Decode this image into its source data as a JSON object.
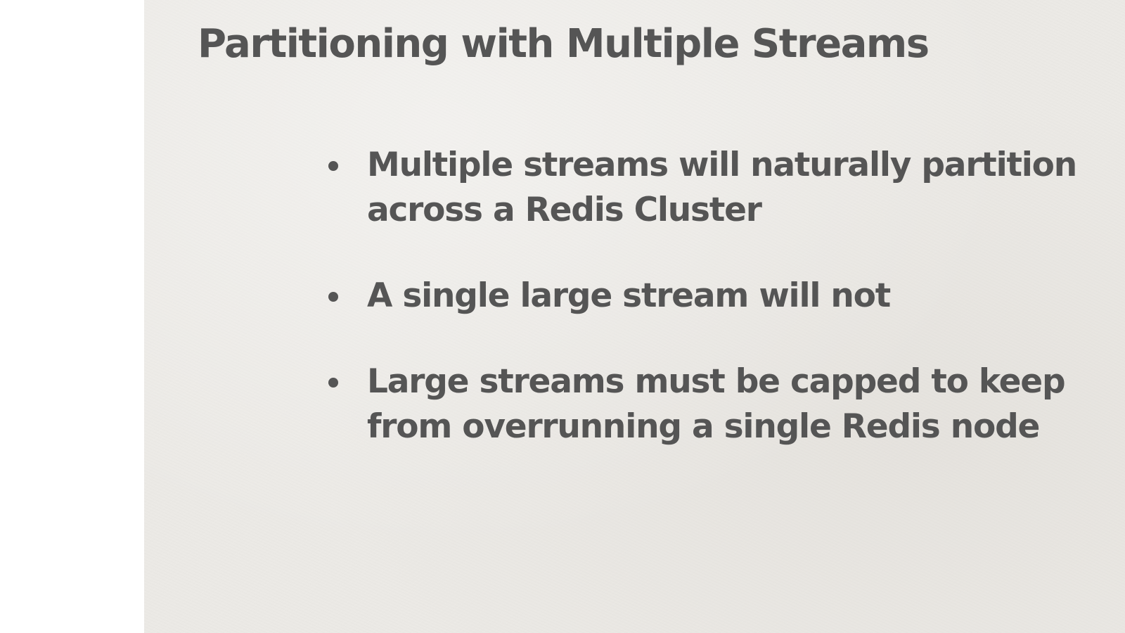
{
  "slide": {
    "title": "Partitioning with Multiple Streams",
    "bullets": [
      {
        "line1": "Multiple streams will naturally partition",
        "line2": "across a Redis Cluster"
      },
      {
        "line1": "A single large stream will not",
        "line2": ""
      },
      {
        "line1": "Large streams must be capped to keep",
        "line2": "from overrunning a single Redis node"
      }
    ]
  },
  "colors": {
    "slide_background": "#ebe9e5",
    "text": "#555555",
    "margin": "#ffffff"
  }
}
